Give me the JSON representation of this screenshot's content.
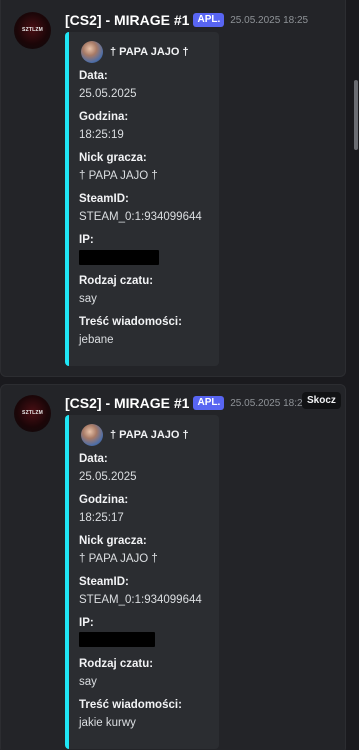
{
  "messages": [
    {
      "avatar_text": "SZTLZM",
      "author": "[CS2] - MIRAGE #1",
      "app_badge": "APL.",
      "timestamp": "25.05.2025 18:25",
      "embed": {
        "author_name": "† PAPA JAJO †",
        "fields": [
          {
            "name": "Data:",
            "value": "25.05.2025"
          },
          {
            "name": "Godzina:",
            "value": "18:25:19"
          },
          {
            "name": "Nick gracza:",
            "value": "† PAPA JAJO †"
          },
          {
            "name": "SteamID:",
            "value": "STEAM_0:1:934099644"
          },
          {
            "name": "IP:",
            "value": ""
          },
          {
            "name": "Rodzaj czatu:",
            "value": "say"
          },
          {
            "name": "Treść wiadomości:",
            "value": "jebane"
          }
        ]
      }
    },
    {
      "avatar_text": "SZTLZM",
      "author": "[CS2] - MIRAGE #1",
      "app_badge": "APL.",
      "timestamp": "25.05.2025 18:25",
      "embed": {
        "author_name": "† PAPA JAJO †",
        "fields": [
          {
            "name": "Data:",
            "value": "25.05.2025"
          },
          {
            "name": "Godzina:",
            "value": "18:25:17"
          },
          {
            "name": "Nick gracza:",
            "value": "† PAPA JAJO †"
          },
          {
            "name": "SteamID:",
            "value": "STEAM_0:1:934099644"
          },
          {
            "name": "IP:",
            "value": ""
          },
          {
            "name": "Rodzaj czatu:",
            "value": "say"
          },
          {
            "name": "Treść wiadomości:",
            "value": "jakie kurwy"
          }
        ]
      }
    }
  ],
  "jump_tooltip": "Skocz",
  "colors": {
    "embed_accent": "#1fe6f5",
    "badge": "#5865f2",
    "background": "#1a1a1e",
    "message_bg": "#232428"
  }
}
